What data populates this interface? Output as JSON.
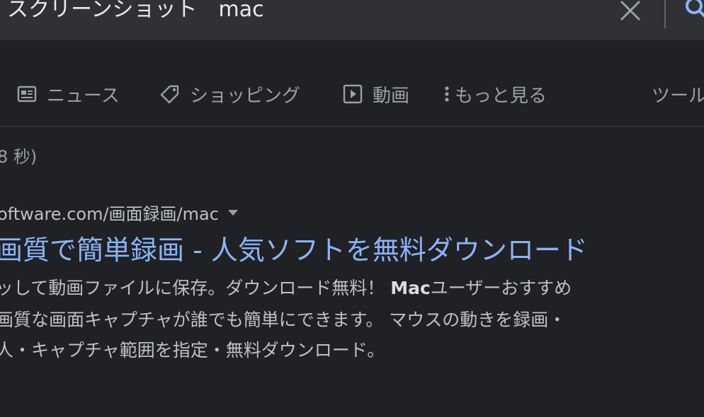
{
  "search": {
    "query": "スクリーンショット　mac"
  },
  "tabs": [
    {
      "label": "ニュース",
      "icon": "news-icon"
    },
    {
      "label": "ショッピング",
      "icon": "tag-icon"
    },
    {
      "label": "動画",
      "icon": "play-icon"
    },
    {
      "label": "もっと見る",
      "icon": "more-vert-icon"
    },
    {
      "label": "ツール"
    }
  ],
  "stats": "8 秒)",
  "result": {
    "url": "oftware.com/画面録画/mac",
    "title": "画質で簡単録画 - 人気ソフトを無料ダウンロード",
    "snippet_line1_a": "ッして動画ファイルに保存。ダウンロード無料！ ",
    "snippet_line1_bold": "Mac",
    "snippet_line1_b": "ユーザーおすすめ",
    "snippet_line2": "画質な画面キャプチャが誰でも簡単にできます。 マウスの動きを録画・",
    "snippet_line3": "人・キャプチャ範囲を指定・無料ダウンロード。"
  },
  "colors": {
    "background": "#202124",
    "searchbar": "#303134",
    "link": "#8ab4f8",
    "muted": "#9aa0a6"
  }
}
